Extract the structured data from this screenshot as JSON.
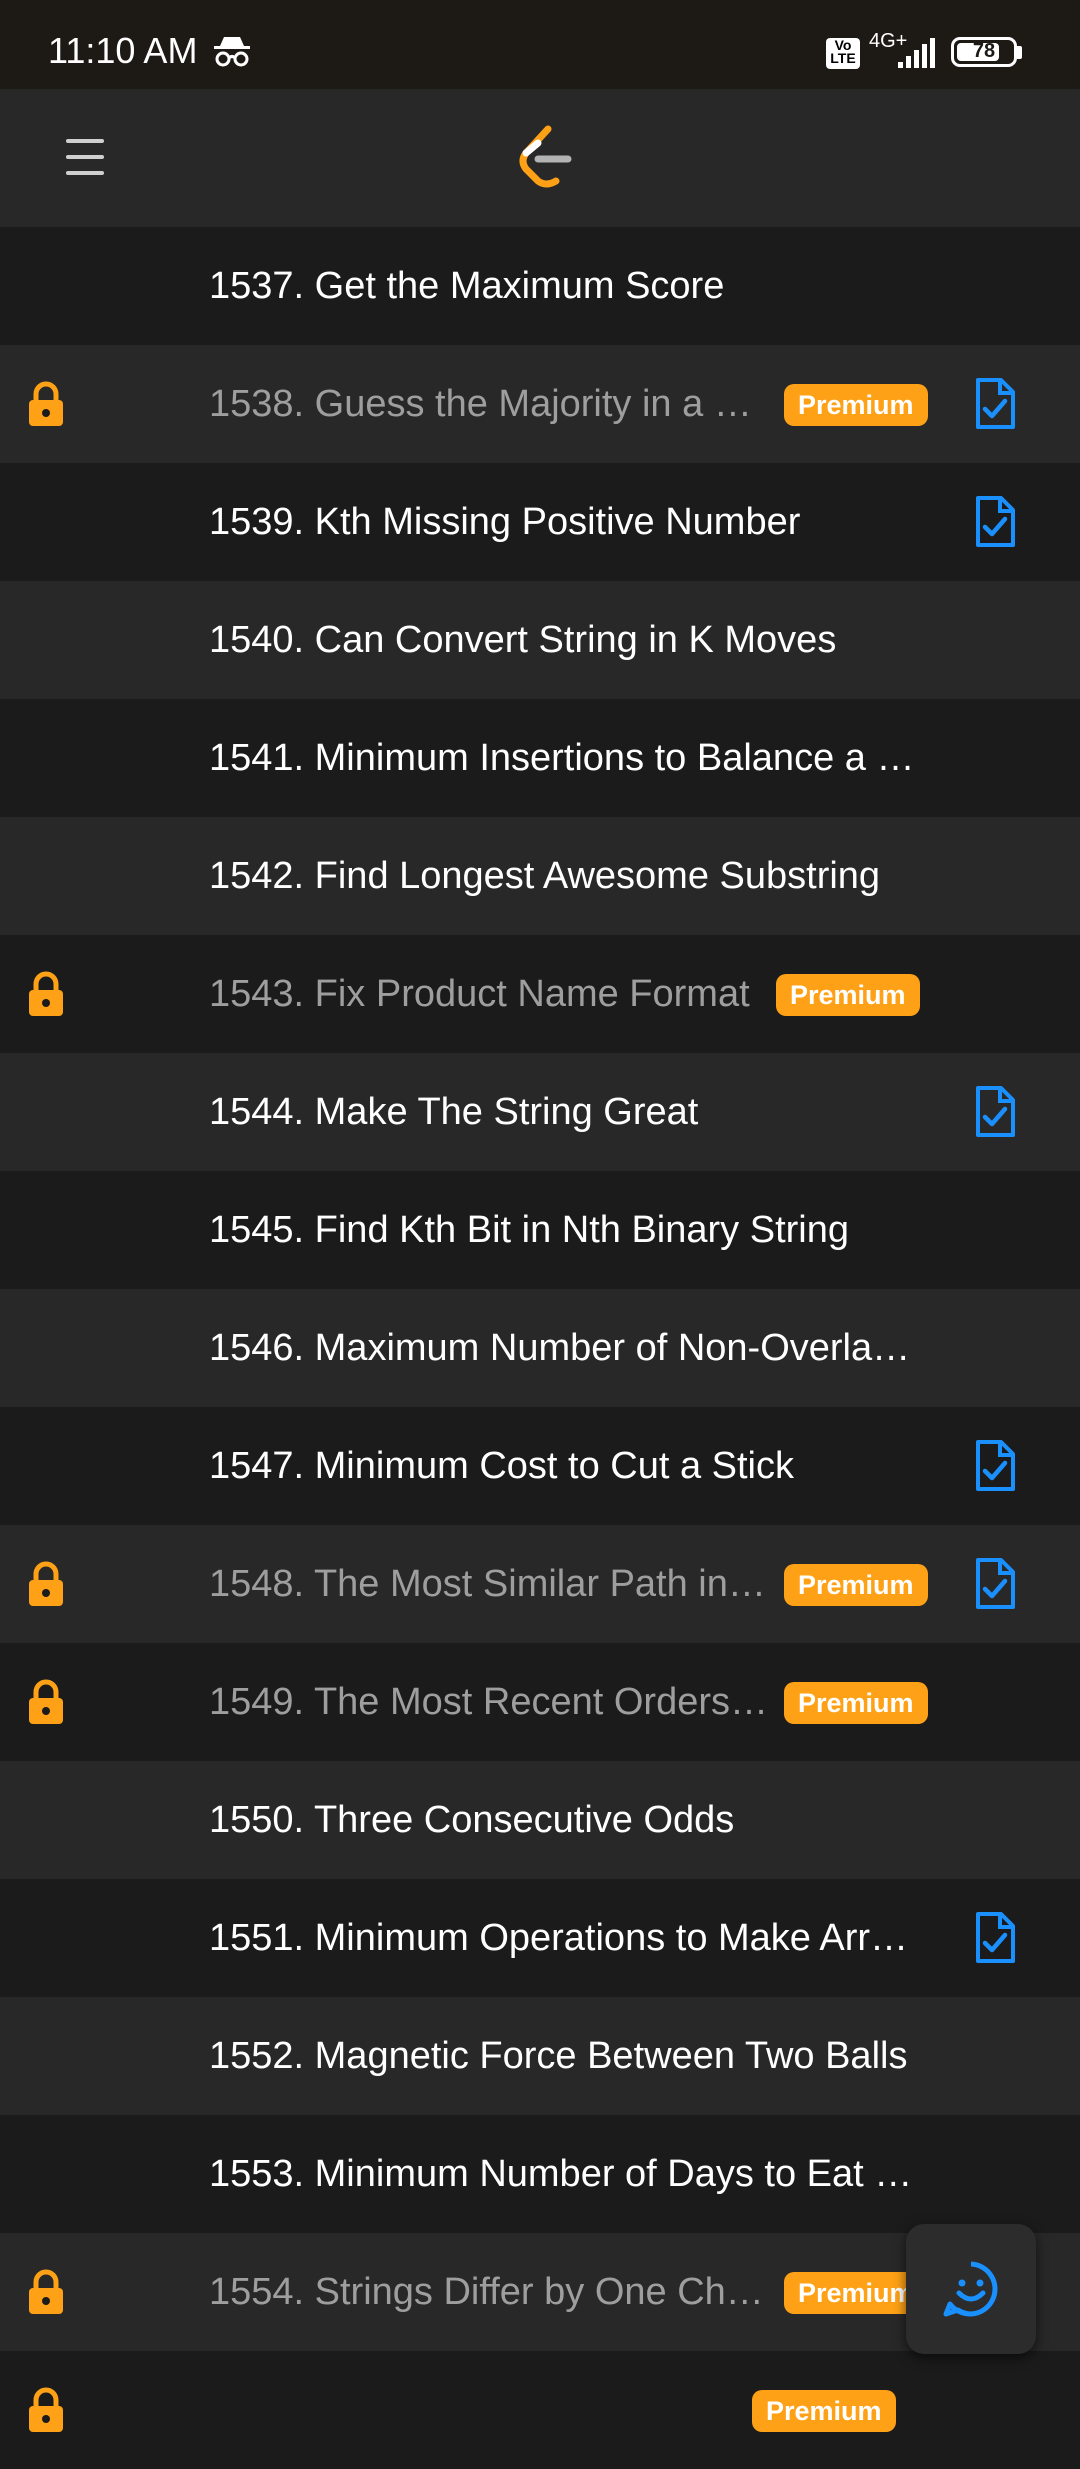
{
  "status": {
    "time": "11:10 AM",
    "network": "4G+",
    "volte": "Vo LTE",
    "battery": "78",
    "battery_level": 0.78
  },
  "appbar": {
    "menu_icon": "hamburger-menu-icon",
    "logo_icon": "leetcode-logo"
  },
  "colors": {
    "premium": "#ffa116",
    "lock": "#ffa116",
    "solution_icon": "#1a90ff"
  },
  "problems": [
    {
      "title": "1537. Get the Maximum Score",
      "locked": false,
      "premium": false,
      "solution": false
    },
    {
      "title": "1538. Guess the Majority in a …",
      "locked": true,
      "premium": true,
      "solution": true
    },
    {
      "title": "1539. Kth Missing Positive Number",
      "locked": false,
      "premium": false,
      "solution": true
    },
    {
      "title": "1540. Can Convert String in K Moves",
      "locked": false,
      "premium": false,
      "solution": false
    },
    {
      "title": "1541. Minimum Insertions to Balance a …",
      "locked": false,
      "premium": false,
      "solution": false
    },
    {
      "title": "1542. Find Longest Awesome Substring",
      "locked": false,
      "premium": false,
      "solution": false
    },
    {
      "title": "1543. Fix Product Name Format",
      "locked": true,
      "premium": true,
      "solution": false
    },
    {
      "title": "1544. Make The String Great",
      "locked": false,
      "premium": false,
      "solution": true
    },
    {
      "title": "1545. Find Kth Bit in Nth Binary String",
      "locked": false,
      "premium": false,
      "solution": false
    },
    {
      "title": "1546. Maximum Number of Non-Overla…",
      "locked": false,
      "premium": false,
      "solution": false
    },
    {
      "title": "1547. Minimum Cost to Cut a Stick",
      "locked": false,
      "premium": false,
      "solution": true
    },
    {
      "title": "1548. The Most Similar Path in…",
      "locked": true,
      "premium": true,
      "solution": true
    },
    {
      "title": "1549. The Most Recent Orders…",
      "locked": true,
      "premium": true,
      "solution": false
    },
    {
      "title": "1550. Three Consecutive Odds",
      "locked": false,
      "premium": false,
      "solution": false
    },
    {
      "title": "1551. Minimum Operations to Make Arr…",
      "locked": false,
      "premium": false,
      "solution": true
    },
    {
      "title": "1552. Magnetic Force Between Two Balls",
      "locked": false,
      "premium": false,
      "solution": false
    },
    {
      "title": "1553. Minimum Number of Days to Eat …",
      "locked": false,
      "premium": false,
      "solution": false
    },
    {
      "title": "1554. Strings Differ by One Ch…",
      "locked": true,
      "premium": true,
      "solution": false
    },
    {
      "title": "",
      "locked": true,
      "premium": true,
      "solution": false
    }
  ],
  "premium_label": "Premium",
  "fab": {
    "icon": "feedback-smiley-icon"
  }
}
